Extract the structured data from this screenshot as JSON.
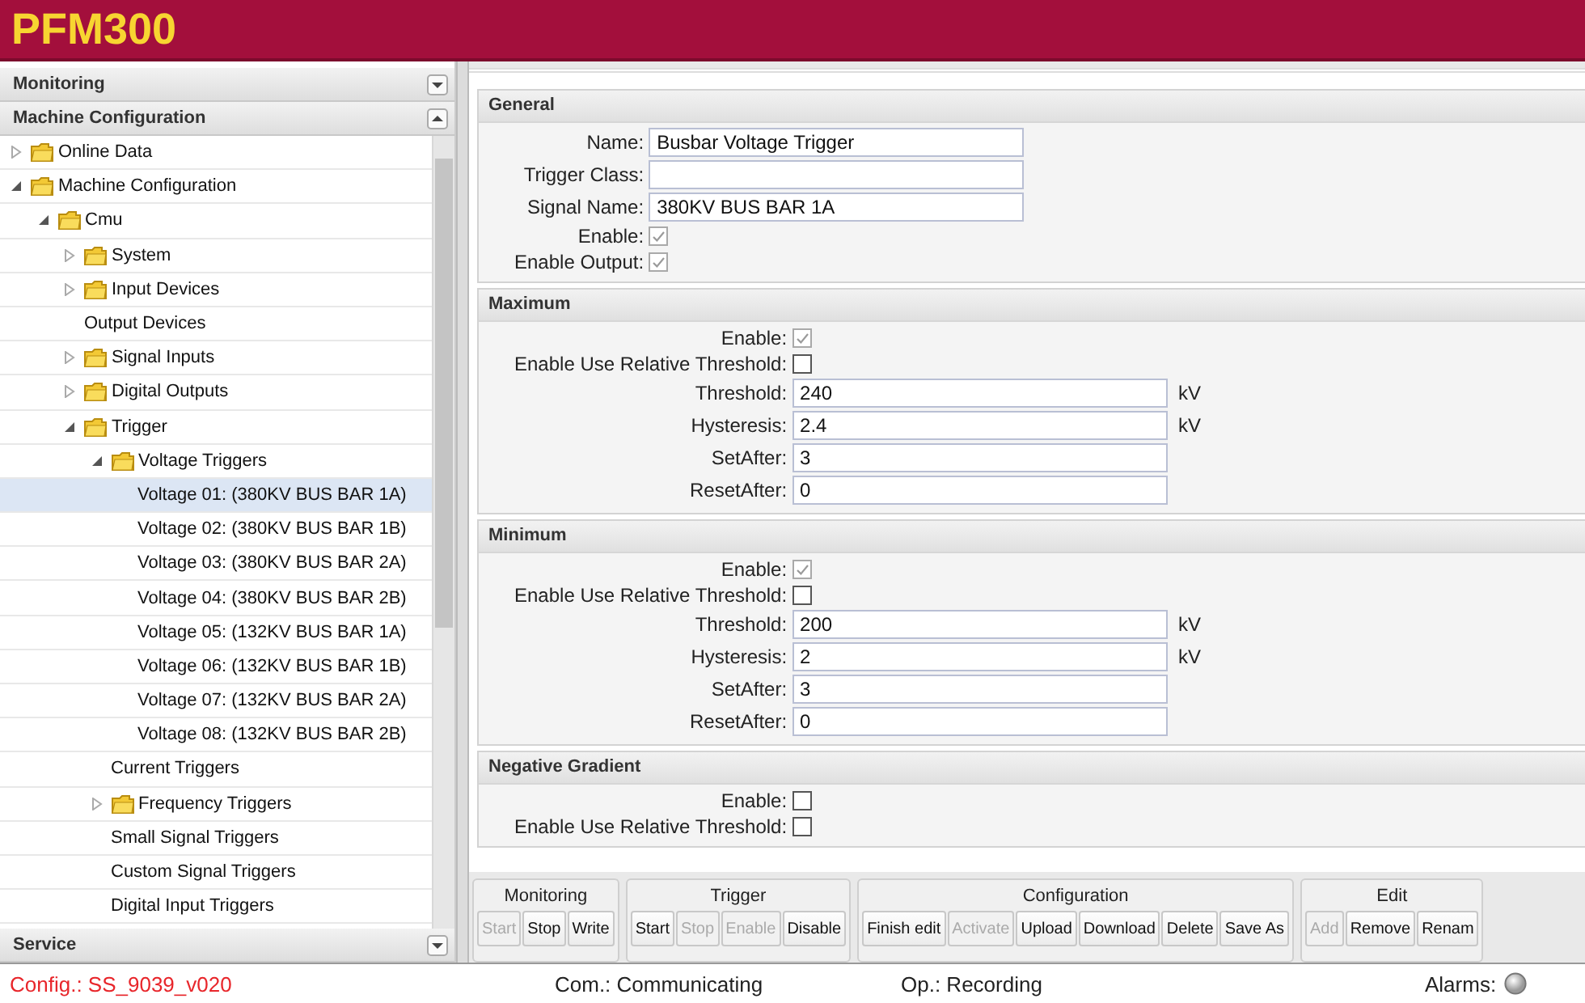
{
  "app": {
    "title": "PFM300"
  },
  "sidebar": {
    "panels": [
      {
        "title": "Monitoring",
        "expanded": false
      },
      {
        "title": "Machine Configuration",
        "expanded": true,
        "tree": [
          {
            "label": "Online Data",
            "kind": "folder",
            "expanded": false,
            "selected": false
          },
          {
            "label": "Machine Configuration",
            "kind": "folder",
            "expanded": true,
            "selected": false,
            "children": [
              {
                "label": "Cmu",
                "kind": "folder",
                "expanded": true,
                "selected": false,
                "children": [
                  {
                    "label": "System",
                    "kind": "folder",
                    "expanded": false,
                    "selected": false
                  },
                  {
                    "label": "Input Devices",
                    "kind": "folder",
                    "expanded": false,
                    "selected": false
                  },
                  {
                    "label": "Output Devices",
                    "kind": "leaf",
                    "selected": false
                  },
                  {
                    "label": "Signal Inputs",
                    "kind": "folder",
                    "expanded": false,
                    "selected": false
                  },
                  {
                    "label": "Digital Outputs",
                    "kind": "folder",
                    "expanded": false,
                    "selected": false
                  },
                  {
                    "label": "Trigger",
                    "kind": "folder",
                    "expanded": true,
                    "selected": false,
                    "children": [
                      {
                        "label": "Voltage Triggers",
                        "kind": "folder",
                        "expanded": true,
                        "selected": false,
                        "children": [
                          {
                            "label": "Voltage 01: (380KV BUS BAR 1A)",
                            "kind": "leaf",
                            "selected": true
                          },
                          {
                            "label": "Voltage 02: (380KV BUS BAR 1B)",
                            "kind": "leaf",
                            "selected": false
                          },
                          {
                            "label": "Voltage 03: (380KV BUS BAR 2A)",
                            "kind": "leaf",
                            "selected": false
                          },
                          {
                            "label": "Voltage 04: (380KV BUS BAR 2B)",
                            "kind": "leaf",
                            "selected": false
                          },
                          {
                            "label": "Voltage 05: (132KV BUS BAR 1A)",
                            "kind": "leaf",
                            "selected": false
                          },
                          {
                            "label": "Voltage 06: (132KV BUS BAR 1B)",
                            "kind": "leaf",
                            "selected": false
                          },
                          {
                            "label": "Voltage 07: (132KV BUS BAR 2A)",
                            "kind": "leaf",
                            "selected": false
                          },
                          {
                            "label": "Voltage 08: (132KV BUS BAR 2B)",
                            "kind": "leaf",
                            "selected": false
                          }
                        ]
                      },
                      {
                        "label": "Current Triggers",
                        "kind": "leaf",
                        "selected": false
                      },
                      {
                        "label": "Frequency Triggers",
                        "kind": "folder",
                        "expanded": false,
                        "selected": false
                      },
                      {
                        "label": "Small Signal Triggers",
                        "kind": "leaf",
                        "selected": false
                      },
                      {
                        "label": "Custom Signal Triggers",
                        "kind": "leaf",
                        "selected": false
                      },
                      {
                        "label": "Digital Input Triggers",
                        "kind": "leaf",
                        "selected": false
                      }
                    ]
                  }
                ]
              }
            ]
          }
        ]
      },
      {
        "title": "Service",
        "expanded": false
      }
    ]
  },
  "form": {
    "sections": [
      {
        "title": "General",
        "fields": [
          {
            "kind": "text",
            "label": "Name:",
            "value": "Busbar Voltage Trigger"
          },
          {
            "kind": "text",
            "label": "Trigger Class:"
          },
          {
            "kind": "text",
            "label": "Signal Name:",
            "value": "380KV BUS BAR 1A"
          },
          {
            "kind": "checkbox",
            "label": "Enable:",
            "checked": true
          },
          {
            "kind": "checkbox",
            "label": "Enable Output:",
            "checked": true
          }
        ]
      },
      {
        "title": "Maximum",
        "fields": [
          {
            "kind": "checkbox",
            "label": "Enable:",
            "checked": true
          },
          {
            "kind": "checkbox",
            "label": "Enable Use Relative Threshold:",
            "checked": false
          },
          {
            "kind": "text",
            "label": "Threshold:",
            "value": "240",
            "unit": "kV"
          },
          {
            "kind": "text",
            "label": "Hysteresis:",
            "value": "2.4",
            "unit": "kV"
          },
          {
            "kind": "text",
            "label": "SetAfter:",
            "value": "3"
          },
          {
            "kind": "text",
            "label": "ResetAfter:",
            "value": "0"
          }
        ]
      },
      {
        "title": "Minimum",
        "fields": [
          {
            "kind": "checkbox",
            "label": "Enable:",
            "checked": true
          },
          {
            "kind": "checkbox",
            "label": "Enable Use Relative Threshold:",
            "checked": false
          },
          {
            "kind": "text",
            "label": "Threshold:",
            "value": "200",
            "unit": "kV"
          },
          {
            "kind": "text",
            "label": "Hysteresis:",
            "value": "2",
            "unit": "kV"
          },
          {
            "kind": "text",
            "label": "SetAfter:",
            "value": "3"
          },
          {
            "kind": "text",
            "label": "ResetAfter:",
            "value": "0"
          }
        ]
      },
      {
        "title": "Negative Gradient",
        "fields": [
          {
            "kind": "checkbox",
            "label": "Enable:",
            "checked": false
          },
          {
            "kind": "checkbox",
            "label": "Enable Use Relative Threshold:",
            "checked": false
          }
        ]
      }
    ]
  },
  "toolbar": {
    "groups": [
      {
        "title": "Monitoring",
        "buttons": [
          {
            "label": "Start",
            "disabled": true
          },
          {
            "label": "Stop",
            "disabled": false
          },
          {
            "label": "Write",
            "disabled": false
          }
        ]
      },
      {
        "title": "Trigger",
        "buttons": [
          {
            "label": "Start",
            "disabled": false
          },
          {
            "label": "Stop",
            "disabled": true
          },
          {
            "label": "Enable",
            "disabled": true
          },
          {
            "label": "Disable",
            "disabled": false
          }
        ]
      },
      {
        "title": "Configuration",
        "buttons": [
          {
            "label": "Finish edit",
            "disabled": false
          },
          {
            "label": "Activate",
            "disabled": true
          },
          {
            "label": "Upload",
            "disabled": false
          },
          {
            "label": "Download",
            "disabled": false
          },
          {
            "label": "Delete",
            "disabled": false
          },
          {
            "label": "Save As",
            "disabled": false
          }
        ]
      },
      {
        "title": "Edit",
        "buttons": [
          {
            "label": "Add",
            "disabled": true
          },
          {
            "label": "Remove",
            "disabled": false
          },
          {
            "label": "Renam",
            "disabled": false
          }
        ]
      }
    ]
  },
  "status_bar": {
    "config": "Config.: SS_9039_v020",
    "communication": "Com.: Communicating",
    "operation": "Op.: Recording",
    "alarms": "Alarms:"
  }
}
